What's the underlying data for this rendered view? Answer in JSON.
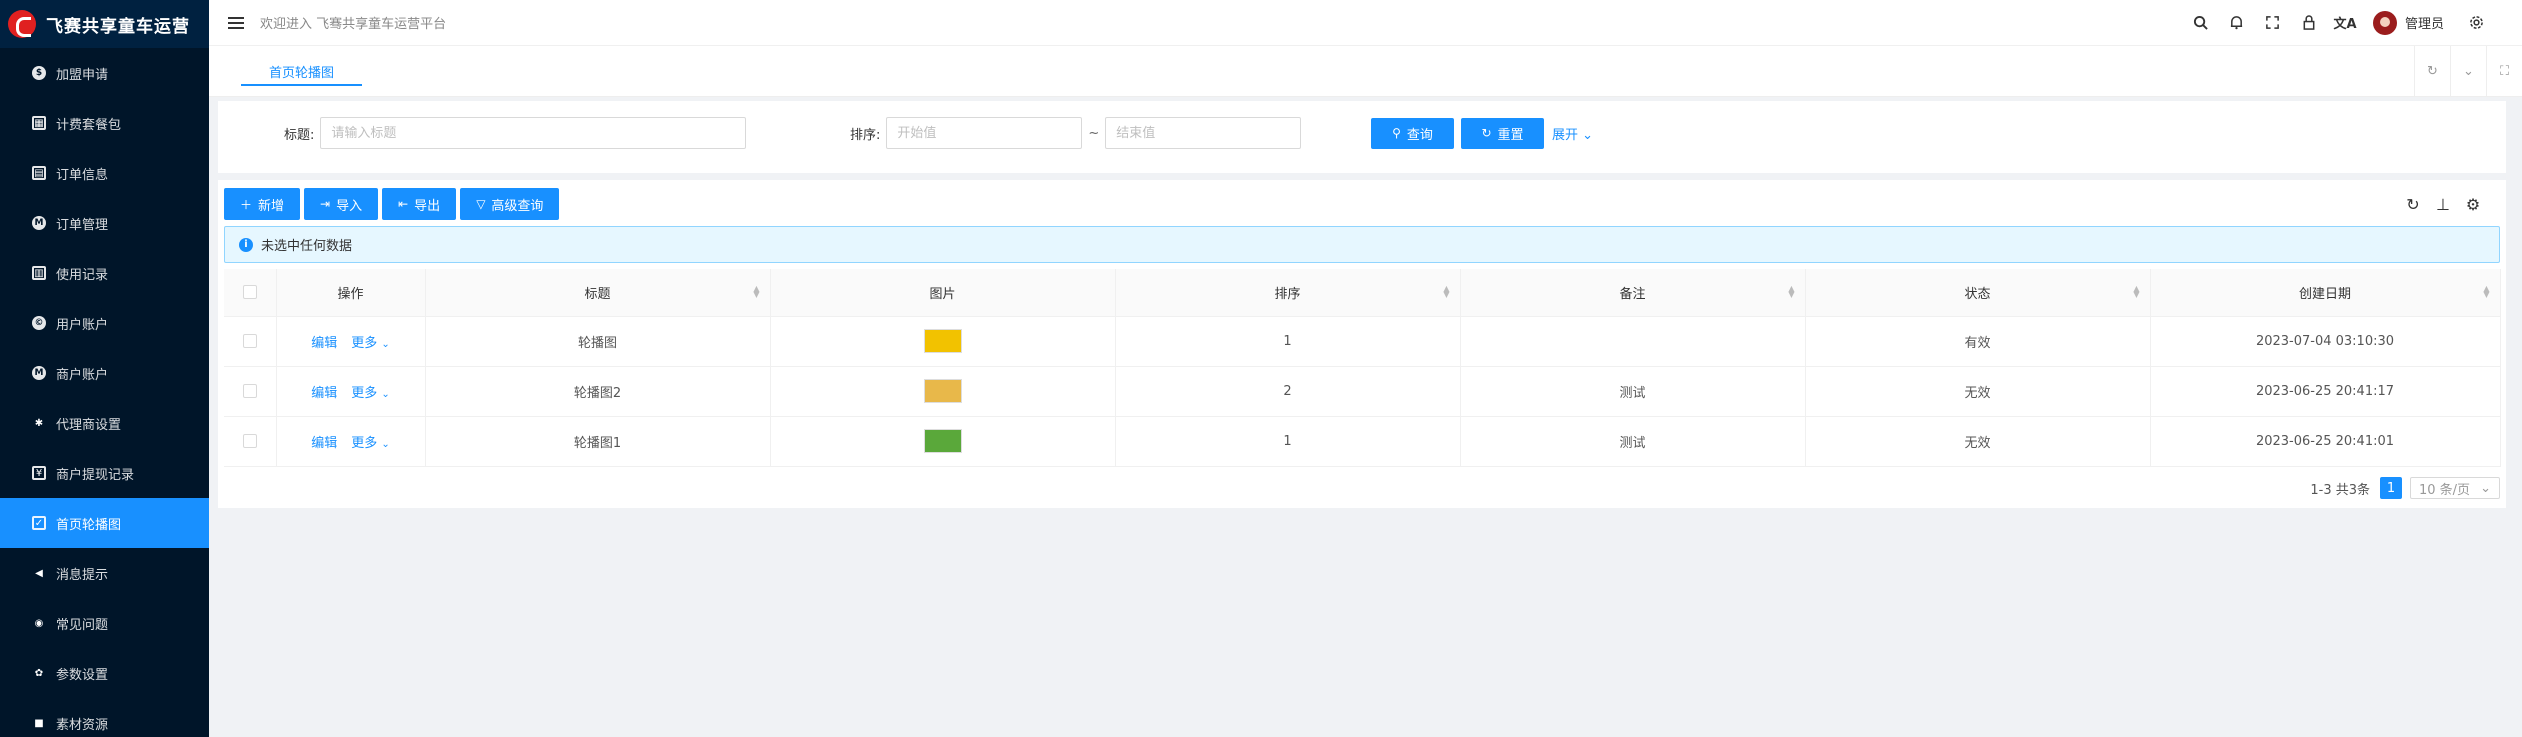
{
  "app": {
    "title": "飞赛共享童车运营"
  },
  "sidebar": {
    "items": [
      {
        "label": "加盟申请",
        "icon": "dollar-circle-icon",
        "glyph": "$",
        "shape": "circle",
        "active": false
      },
      {
        "label": "计费套餐包",
        "icon": "package-icon",
        "glyph": "▦",
        "shape": "square",
        "active": false
      },
      {
        "label": "订单信息",
        "icon": "order-icon",
        "glyph": "▤",
        "shape": "square",
        "active": false
      },
      {
        "label": "订单管理",
        "icon": "m-circle-icon",
        "glyph": "M",
        "shape": "circle",
        "active": false
      },
      {
        "label": "使用记录",
        "icon": "record-icon",
        "glyph": "▥",
        "shape": "square",
        "active": false
      },
      {
        "label": "用户账户",
        "icon": "copyright-circle-icon",
        "glyph": "©",
        "shape": "circle",
        "active": false
      },
      {
        "label": "商户账户",
        "icon": "merchant-circle-icon",
        "glyph": "M",
        "shape": "circle",
        "active": false
      },
      {
        "label": "代理商设置",
        "icon": "android-icon",
        "glyph": "✱",
        "shape": "none",
        "active": false
      },
      {
        "label": "商户提现记录",
        "icon": "withdraw-icon",
        "glyph": "¥",
        "shape": "square",
        "active": false
      },
      {
        "label": "首页轮播图",
        "icon": "carousel-icon",
        "glyph": "✓",
        "shape": "square",
        "active": true
      },
      {
        "label": "消息提示",
        "icon": "sound-icon",
        "glyph": "◀",
        "shape": "none",
        "active": false
      },
      {
        "label": "常见问题",
        "icon": "eye-icon",
        "glyph": "◉",
        "shape": "none",
        "active": false
      },
      {
        "label": "参数设置",
        "icon": "setting-icon",
        "glyph": "✿",
        "shape": "none",
        "active": false
      },
      {
        "label": "素材资源",
        "icon": "video-icon",
        "glyph": "■",
        "shape": "none",
        "active": false
      }
    ]
  },
  "header": {
    "welcome": "欢迎进入 飞骞共享童车运营平台",
    "icons": [
      "search-icon",
      "bell-icon",
      "fullscreen-icon",
      "lock-icon",
      "translate-icon"
    ],
    "username": "管理员"
  },
  "tabs": [
    {
      "label": "首页轮播图"
    }
  ],
  "search": {
    "title_label": "标题:",
    "title_placeholder": "请输入标题",
    "sort_label": "排序:",
    "start_placeholder": "开始值",
    "range_sep": "~",
    "end_placeholder": "结束值",
    "query_label": "查询",
    "reset_label": "重置",
    "expand_label": "展开"
  },
  "toolbar": {
    "add_label": "新增",
    "import_label": "导入",
    "export_label": "导出",
    "advanced_label": "高级查询"
  },
  "alert": {
    "text": "未选中任何数据"
  },
  "table": {
    "headers": [
      "操作",
      "标题",
      "图片",
      "排序",
      "备注",
      "状态",
      "创建日期"
    ],
    "edit_label": "编辑",
    "more_label": "更多",
    "rows": [
      {
        "title": "轮播图",
        "image_color": "#f2c200",
        "sort": "1",
        "remark": "",
        "status": "有效",
        "created": "2023-07-04 03:10:30"
      },
      {
        "title": "轮播图2",
        "image_color": "#e8b84a",
        "sort": "2",
        "remark": "测试",
        "status": "无效",
        "created": "2023-06-25 20:41:17"
      },
      {
        "title": "轮播图1",
        "image_color": "#5aa83a",
        "sort": "1",
        "remark": "测试",
        "status": "无效",
        "created": "2023-06-25 20:41:01"
      }
    ]
  },
  "pagination": {
    "total": "1-3 共3条",
    "current": "1",
    "page_size": "10 条/页"
  },
  "colors": {
    "primary": "#1890ff",
    "sidebar": "#001529"
  }
}
